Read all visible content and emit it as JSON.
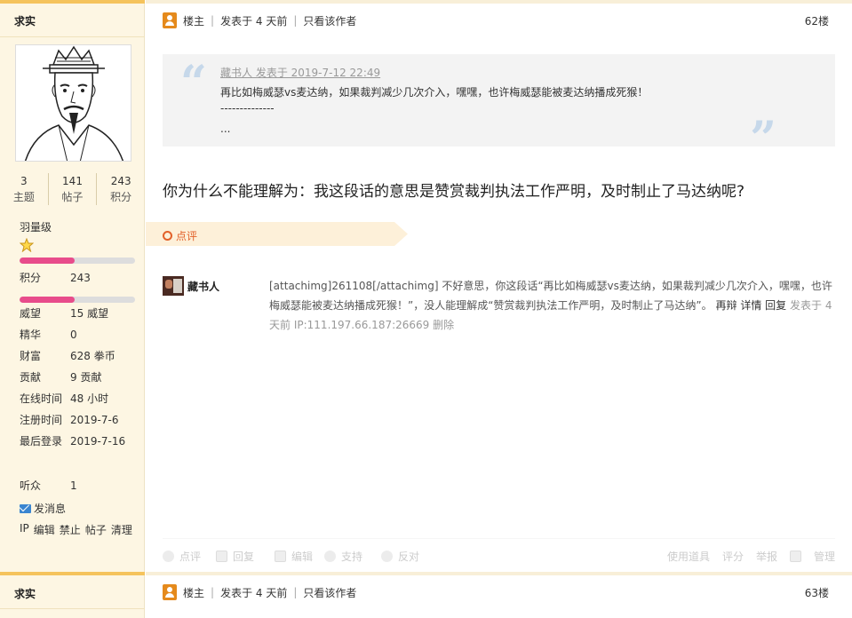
{
  "sidebar": {
    "username": "求实",
    "stats": [
      {
        "num": "3",
        "label": "主题"
      },
      {
        "num": "141",
        "label": "帖子"
      },
      {
        "num": "243",
        "label": "积分"
      }
    ],
    "level": "羽量级",
    "level_progress": 0.48,
    "points_label": "积分",
    "points_value": "243",
    "points_progress": 0.48,
    "info": [
      {
        "k": "威望",
        "v": "15 威望"
      },
      {
        "k": "精华",
        "v": "0"
      },
      {
        "k": "财富",
        "v": "628 拳币"
      },
      {
        "k": "贡献",
        "v": "9 贡献"
      },
      {
        "k": "在线时间",
        "v": "48 小时"
      },
      {
        "k": "注册时间",
        "v": "2019-7-6"
      },
      {
        "k": "最后登录",
        "v": "2019-7-16"
      }
    ],
    "listeners_label": "听众",
    "listeners_value": "1",
    "send_message": "发消息",
    "admin_links": [
      "IP",
      "编辑",
      "禁止",
      "帖子",
      "清理"
    ],
    "next_username": "求实"
  },
  "post": {
    "owner_label": "楼主",
    "posted": "发表于 4 天前",
    "only_author": "只看该作者",
    "floor": "62楼",
    "quote": {
      "author_line": "藏书人 发表于 2019-7-12 22:49",
      "text": "再比如梅威瑟vs麦达纳，如果裁判减少几次介入，嘿嘿，也许梅威瑟能被麦达纳播成死猴！",
      "dashes": "--------------",
      "ellipsis": "..."
    },
    "content": "你为什么不能理解为：我这段话的意思是赞赏裁判执法工作严明，及时制止了马达纳呢?",
    "dianping_label": "点评",
    "comment": {
      "author": "藏书人",
      "text": "[attachimg]261108[/attachimg] 不好意思，你这段话“再比如梅威瑟vs麦达纳，如果裁判减少几次介入，嘿嘿，也许梅威瑟能被麦达纳播成死猴！”，没人能理解成“赞赏裁判执法工作严明，及时制止了马达纳”。",
      "rebut": "再辩",
      "detail": "详情",
      "reply": "回复",
      "posted": "发表于 4 天前",
      "ip": "IP:111.197.66.187:26669",
      "delete": "删除"
    },
    "footer_left": [
      "点评",
      "回复",
      "编辑",
      "支持",
      "反对"
    ],
    "footer_right": [
      "使用道具",
      "评分",
      "举报",
      "管理"
    ]
  },
  "next_post": {
    "owner_label": "楼主",
    "posted": "发表于 4 天前",
    "only_author": "只看该作者",
    "floor": "63楼"
  }
}
